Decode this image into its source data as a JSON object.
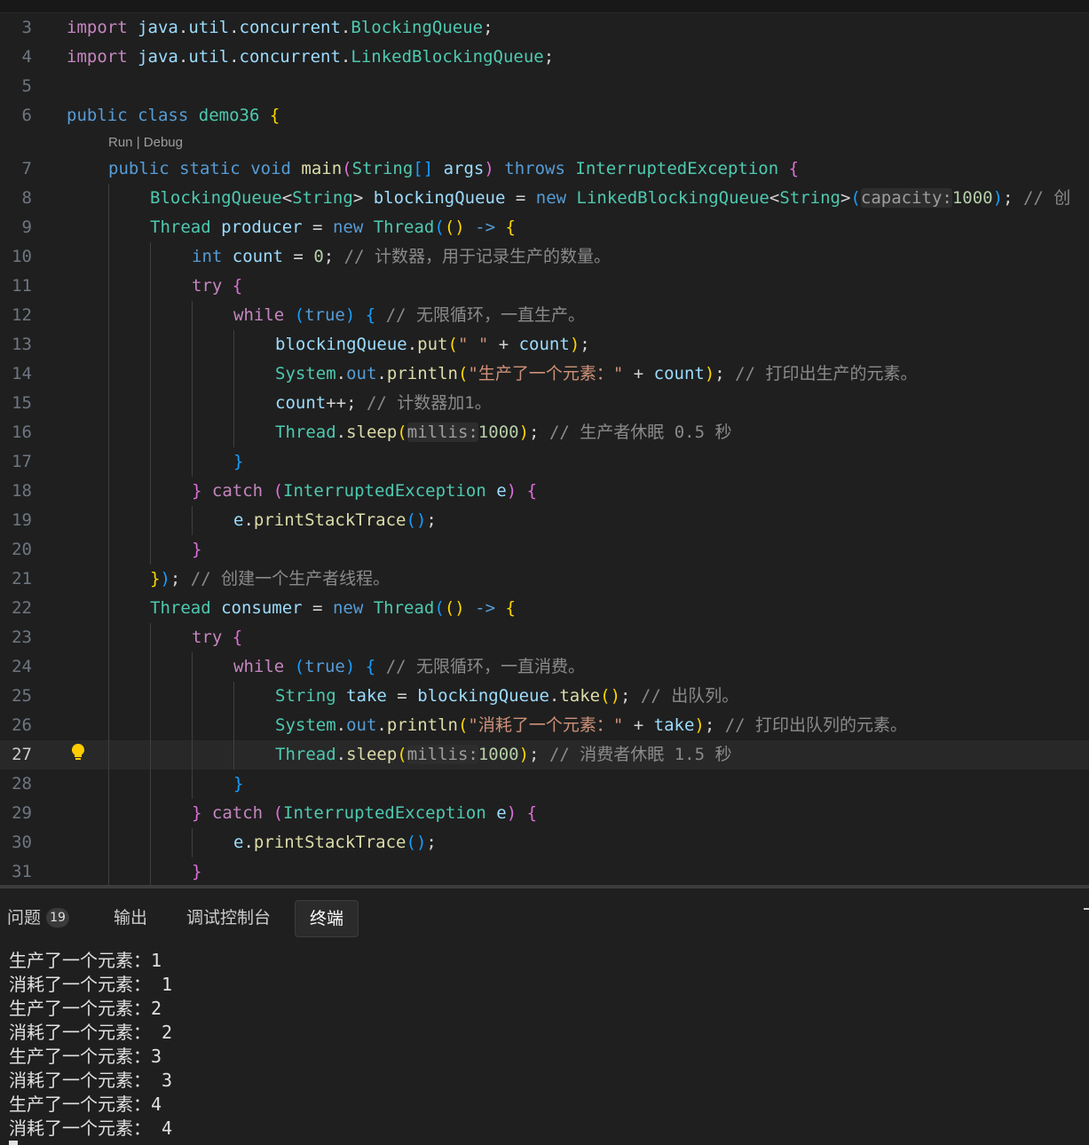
{
  "editor": {
    "current_line": 27,
    "codelens": {
      "run": "Run",
      "separator": " | ",
      "debug": "Debug"
    },
    "lines": [
      {
        "no": "3",
        "indent": 0,
        "tokens": [
          [
            "k",
            "import"
          ],
          [
            "p",
            " "
          ],
          [
            "v",
            "java"
          ],
          [
            "p",
            "."
          ],
          [
            "v",
            "util"
          ],
          [
            "p",
            "."
          ],
          [
            "v",
            "concurrent"
          ],
          [
            "p",
            "."
          ],
          [
            "t",
            "BlockingQueue"
          ],
          [
            "p",
            ";"
          ]
        ]
      },
      {
        "no": "4",
        "indent": 0,
        "tokens": [
          [
            "k",
            "import"
          ],
          [
            "p",
            " "
          ],
          [
            "v",
            "java"
          ],
          [
            "p",
            "."
          ],
          [
            "v",
            "util"
          ],
          [
            "p",
            "."
          ],
          [
            "v",
            "concurrent"
          ],
          [
            "p",
            "."
          ],
          [
            "t",
            "LinkedBlockingQueue"
          ],
          [
            "p",
            ";"
          ]
        ]
      },
      {
        "no": "5",
        "indent": 0,
        "tokens": []
      },
      {
        "no": "6",
        "indent": 0,
        "lens": true,
        "tokens": [
          [
            "b",
            "public"
          ],
          [
            "p",
            " "
          ],
          [
            "b",
            "class"
          ],
          [
            "p",
            " "
          ],
          [
            "t",
            "demo36"
          ],
          [
            "p",
            " "
          ],
          [
            "br1",
            "{"
          ]
        ]
      },
      {
        "no": "7",
        "indent": 1,
        "tokens": [
          [
            "b",
            "public"
          ],
          [
            "p",
            " "
          ],
          [
            "b",
            "static"
          ],
          [
            "p",
            " "
          ],
          [
            "b",
            "void"
          ],
          [
            "p",
            " "
          ],
          [
            "f",
            "main"
          ],
          [
            "br2",
            "("
          ],
          [
            "t",
            "String"
          ],
          [
            "br3",
            "[]"
          ],
          [
            "p",
            " "
          ],
          [
            "v",
            "args"
          ],
          [
            "br2",
            ")"
          ],
          [
            "p",
            " "
          ],
          [
            "b",
            "throws"
          ],
          [
            "p",
            " "
          ],
          [
            "t",
            "InterruptedException"
          ],
          [
            "p",
            " "
          ],
          [
            "br2",
            "{"
          ]
        ]
      },
      {
        "no": "8",
        "indent": 2,
        "tokens": [
          [
            "t",
            "BlockingQueue"
          ],
          [
            "p",
            "<"
          ],
          [
            "t",
            "String"
          ],
          [
            "p",
            "> "
          ],
          [
            "v",
            "blockingQueue"
          ],
          [
            "p",
            " = "
          ],
          [
            "b",
            "new"
          ],
          [
            "p",
            " "
          ],
          [
            "t",
            "LinkedBlockingQueue"
          ],
          [
            "p",
            "<"
          ],
          [
            "t",
            "String"
          ],
          [
            "p",
            ">"
          ],
          [
            "br3",
            "("
          ],
          [
            "hint",
            "capacity:"
          ],
          [
            "n",
            "1000"
          ],
          [
            "br3",
            ")"
          ],
          [
            "p",
            "; "
          ],
          [
            "cm",
            "// 创"
          ]
        ]
      },
      {
        "no": "9",
        "indent": 2,
        "tokens": [
          [
            "t",
            "Thread"
          ],
          [
            "p",
            " "
          ],
          [
            "v",
            "producer"
          ],
          [
            "p",
            " = "
          ],
          [
            "b",
            "new"
          ],
          [
            "p",
            " "
          ],
          [
            "t",
            "Thread"
          ],
          [
            "br3",
            "("
          ],
          [
            "br1",
            "()"
          ],
          [
            "p",
            " "
          ],
          [
            "b",
            "->"
          ],
          [
            "p",
            " "
          ],
          [
            "br1",
            "{"
          ]
        ]
      },
      {
        "no": "10",
        "indent": 3,
        "tokens": [
          [
            "b",
            "int"
          ],
          [
            "p",
            " "
          ],
          [
            "v",
            "count"
          ],
          [
            "p",
            " = "
          ],
          [
            "n",
            "0"
          ],
          [
            "p",
            "; "
          ],
          [
            "cm",
            "// 计数器，用于记录生产的数量。"
          ]
        ]
      },
      {
        "no": "11",
        "indent": 3,
        "tokens": [
          [
            "k",
            "try"
          ],
          [
            "p",
            " "
          ],
          [
            "br2",
            "{"
          ]
        ]
      },
      {
        "no": "12",
        "indent": 4,
        "tokens": [
          [
            "k",
            "while"
          ],
          [
            "p",
            " "
          ],
          [
            "br3",
            "("
          ],
          [
            "b",
            "true"
          ],
          [
            "br3",
            ")"
          ],
          [
            "p",
            " "
          ],
          [
            "br3",
            "{"
          ],
          [
            "p",
            " "
          ],
          [
            "cm",
            "// 无限循环，一直生产。"
          ]
        ]
      },
      {
        "no": "13",
        "indent": 5,
        "tokens": [
          [
            "v",
            "blockingQueue"
          ],
          [
            "p",
            "."
          ],
          [
            "f",
            "put"
          ],
          [
            "br1",
            "("
          ],
          [
            "s",
            "\" \""
          ],
          [
            "p",
            " + "
          ],
          [
            "v",
            "count"
          ],
          [
            "br1",
            ")"
          ],
          [
            "p",
            ";"
          ]
        ]
      },
      {
        "no": "14",
        "indent": 5,
        "tokens": [
          [
            "t",
            "System"
          ],
          [
            "p",
            "."
          ],
          [
            "b",
            "out"
          ],
          [
            "p",
            "."
          ],
          [
            "f",
            "println"
          ],
          [
            "br1",
            "("
          ],
          [
            "s",
            "\"生产了一个元素：\""
          ],
          [
            "p",
            " + "
          ],
          [
            "v",
            "count"
          ],
          [
            "br1",
            ")"
          ],
          [
            "p",
            "; "
          ],
          [
            "cm",
            "// 打印出生产的元素。"
          ]
        ]
      },
      {
        "no": "15",
        "indent": 5,
        "tokens": [
          [
            "v",
            "count"
          ],
          [
            "p",
            "++; "
          ],
          [
            "cm",
            "// 计数器加1。"
          ]
        ]
      },
      {
        "no": "16",
        "indent": 5,
        "tokens": [
          [
            "t",
            "Thread"
          ],
          [
            "p",
            "."
          ],
          [
            "f",
            "sleep"
          ],
          [
            "br1",
            "("
          ],
          [
            "hint",
            "millis:"
          ],
          [
            "n",
            "1000"
          ],
          [
            "br1",
            ")"
          ],
          [
            "p",
            "; "
          ],
          [
            "cm",
            "// 生产者休眠 0.5 秒"
          ]
        ]
      },
      {
        "no": "17",
        "indent": 4,
        "tokens": [
          [
            "br3",
            "}"
          ]
        ]
      },
      {
        "no": "18",
        "indent": 3,
        "tokens": [
          [
            "br2",
            "}"
          ],
          [
            "p",
            " "
          ],
          [
            "k",
            "catch"
          ],
          [
            "p",
            " "
          ],
          [
            "br2",
            "("
          ],
          [
            "t",
            "InterruptedException"
          ],
          [
            "p",
            " "
          ],
          [
            "v",
            "e"
          ],
          [
            "br2",
            ")"
          ],
          [
            "p",
            " "
          ],
          [
            "br2",
            "{"
          ]
        ]
      },
      {
        "no": "19",
        "indent": 4,
        "tokens": [
          [
            "v",
            "e"
          ],
          [
            "p",
            "."
          ],
          [
            "f",
            "printStackTrace"
          ],
          [
            "br3",
            "()"
          ],
          [
            "p",
            ";"
          ]
        ]
      },
      {
        "no": "20",
        "indent": 3,
        "tokens": [
          [
            "br2",
            "}"
          ]
        ]
      },
      {
        "no": "21",
        "indent": 2,
        "tokens": [
          [
            "br1",
            "}"
          ],
          [
            "br3",
            ")"
          ],
          [
            "p",
            "; "
          ],
          [
            "cm",
            "// 创建一个生产者线程。"
          ]
        ]
      },
      {
        "no": "22",
        "indent": 2,
        "tokens": [
          [
            "t",
            "Thread"
          ],
          [
            "p",
            " "
          ],
          [
            "v",
            "consumer"
          ],
          [
            "p",
            " = "
          ],
          [
            "b",
            "new"
          ],
          [
            "p",
            " "
          ],
          [
            "t",
            "Thread"
          ],
          [
            "br3",
            "("
          ],
          [
            "br1",
            "()"
          ],
          [
            "p",
            " "
          ],
          [
            "b",
            "->"
          ],
          [
            "p",
            " "
          ],
          [
            "br1",
            "{"
          ]
        ]
      },
      {
        "no": "23",
        "indent": 3,
        "tokens": [
          [
            "k",
            "try"
          ],
          [
            "p",
            " "
          ],
          [
            "br2",
            "{"
          ]
        ]
      },
      {
        "no": "24",
        "indent": 4,
        "tokens": [
          [
            "k",
            "while"
          ],
          [
            "p",
            " "
          ],
          [
            "br3",
            "("
          ],
          [
            "b",
            "true"
          ],
          [
            "br3",
            ")"
          ],
          [
            "p",
            " "
          ],
          [
            "br3",
            "{"
          ],
          [
            "p",
            " "
          ],
          [
            "cm",
            "// 无限循环，一直消费。"
          ]
        ]
      },
      {
        "no": "25",
        "indent": 5,
        "tokens": [
          [
            "t",
            "String"
          ],
          [
            "p",
            " "
          ],
          [
            "v",
            "take"
          ],
          [
            "p",
            " = "
          ],
          [
            "v",
            "blockingQueue"
          ],
          [
            "p",
            "."
          ],
          [
            "f",
            "take"
          ],
          [
            "br1",
            "()"
          ],
          [
            "p",
            "; "
          ],
          [
            "cm",
            "// 出队列。"
          ]
        ]
      },
      {
        "no": "26",
        "indent": 5,
        "tokens": [
          [
            "t",
            "System"
          ],
          [
            "p",
            "."
          ],
          [
            "b",
            "out"
          ],
          [
            "p",
            "."
          ],
          [
            "f",
            "println"
          ],
          [
            "br1",
            "("
          ],
          [
            "s",
            "\"消耗了一个元素：\""
          ],
          [
            "p",
            " + "
          ],
          [
            "v",
            "take"
          ],
          [
            "br1",
            ")"
          ],
          [
            "p",
            "; "
          ],
          [
            "cm",
            "// 打印出队列的元素。"
          ]
        ]
      },
      {
        "no": "27",
        "indent": 5,
        "tokens": [
          [
            "t",
            "Thread"
          ],
          [
            "p",
            "."
          ],
          [
            "f",
            "sleep"
          ],
          [
            "br1",
            "("
          ],
          [
            "hint",
            "millis:"
          ],
          [
            "n",
            "1000"
          ],
          [
            "br1",
            ")"
          ],
          [
            "p",
            "; "
          ],
          [
            "cm",
            "// 消费者休眠 1.5 秒"
          ]
        ]
      },
      {
        "no": "28",
        "indent": 4,
        "tokens": [
          [
            "br3",
            "}"
          ]
        ]
      },
      {
        "no": "29",
        "indent": 3,
        "tokens": [
          [
            "br2",
            "}"
          ],
          [
            "p",
            " "
          ],
          [
            "k",
            "catch"
          ],
          [
            "p",
            " "
          ],
          [
            "br2",
            "("
          ],
          [
            "t",
            "InterruptedException"
          ],
          [
            "p",
            " "
          ],
          [
            "v",
            "e"
          ],
          [
            "br2",
            ")"
          ],
          [
            "p",
            " "
          ],
          [
            "br2",
            "{"
          ]
        ]
      },
      {
        "no": "30",
        "indent": 4,
        "tokens": [
          [
            "v",
            "e"
          ],
          [
            "p",
            "."
          ],
          [
            "f",
            "printStackTrace"
          ],
          [
            "br3",
            "()"
          ],
          [
            "p",
            ";"
          ]
        ]
      },
      {
        "no": "31",
        "indent": 3,
        "tokens": [
          [
            "br2",
            "}"
          ]
        ]
      }
    ]
  },
  "panel": {
    "tabs": [
      {
        "label": "问题",
        "badge": "19",
        "active": false
      },
      {
        "label": "输出",
        "active": false
      },
      {
        "label": "调试控制台",
        "active": false
      },
      {
        "label": "终端",
        "active": true
      }
    ],
    "terminal_lines": [
      "生产了一个元素：1",
      "消耗了一个元素： 1",
      "生产了一个元素：2",
      "消耗了一个元素： 2",
      "生产了一个元素：3",
      "消耗了一个元素： 3",
      "生产了一个元素：4",
      "消耗了一个元素： 4"
    ]
  },
  "colors": {
    "background": "#1f1f1f",
    "keyword": "#c586c0",
    "type": "#4ec9b0",
    "comment": "#8a8a8a",
    "lightbulb": "#ffcc00"
  },
  "icons": {
    "code_action": "lightbulb-icon",
    "new_terminal": "plus-icon"
  }
}
